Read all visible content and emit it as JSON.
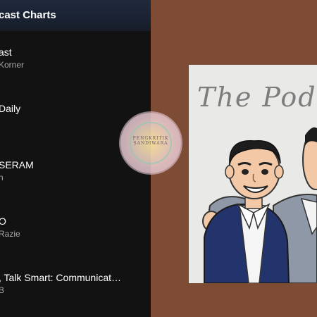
{
  "header": {
    "title": "cast Charts"
  },
  "episodes": [
    {
      "title": "ast",
      "subtitle": "Korner"
    },
    {
      "title": "Daily",
      "subtitle": ""
    },
    {
      "title": "SERAM",
      "subtitle": "n"
    },
    {
      "title": "O",
      "subtitle": "Razie"
    },
    {
      "title": ", Talk Smart: Communicat…",
      "subtitle": "B"
    }
  ],
  "cover": {
    "title": "The Pod"
  },
  "stamp": {
    "line1": "PENGKRITIK",
    "line2": "SANDIWARA"
  },
  "colors": {
    "sidebar_bg": "#121212",
    "header_bg": "#1f2a3d",
    "right_bg": "#7e4b35",
    "text_primary": "#ffffff",
    "text_secondary": "#a7a7a7"
  }
}
